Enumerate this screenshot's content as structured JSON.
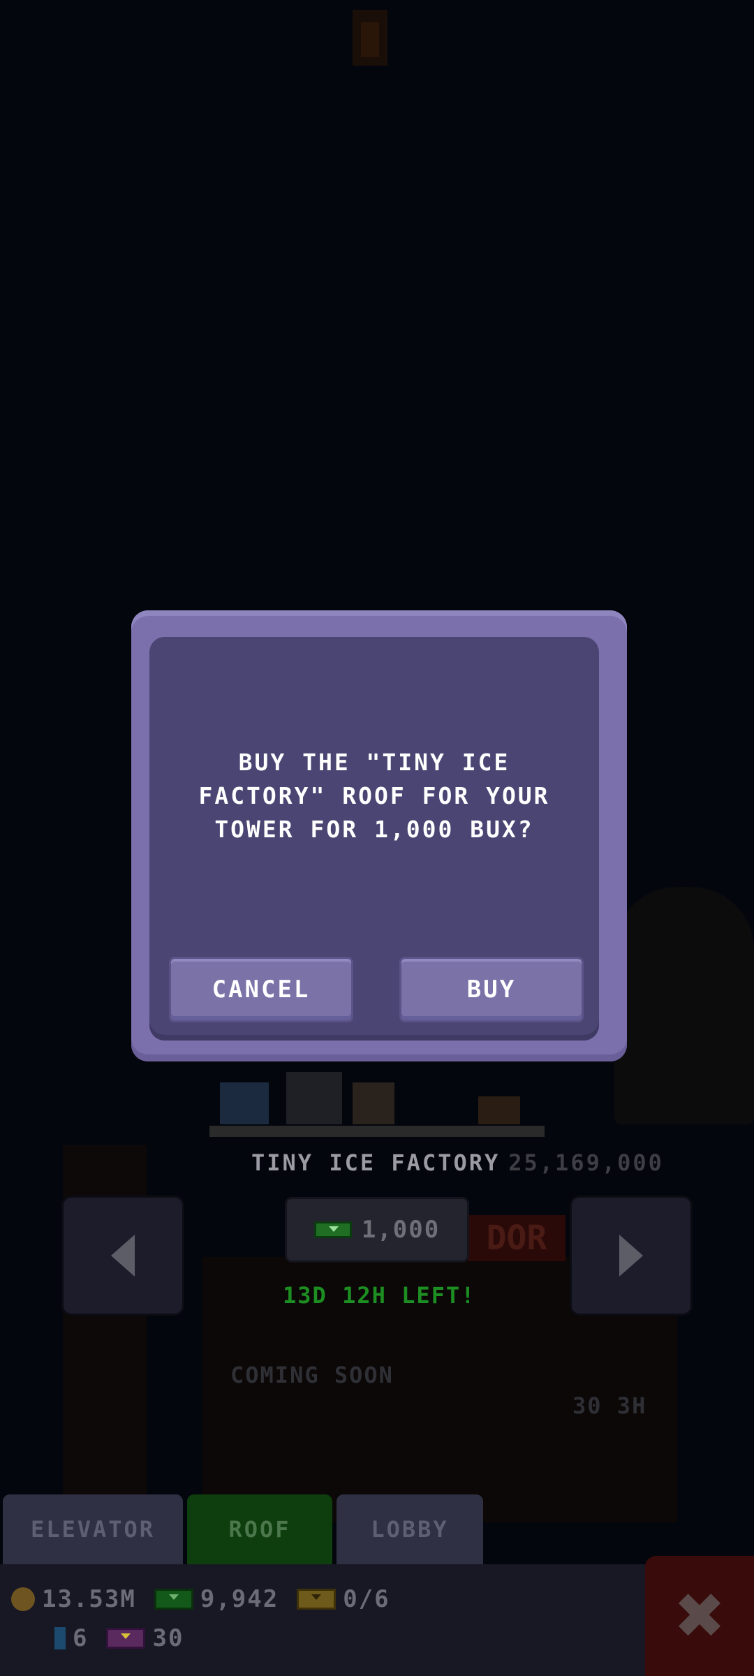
{
  "dialog": {
    "message": "BUY THE \"TINY ICE\nFACTORY\" ROOF FOR YOUR\nTOWER FOR 1,000 BUX?",
    "cancel_label": "CANCEL",
    "buy_label": "BUY"
  },
  "roof_panel": {
    "title": "TINY ICE FACTORY",
    "dim_count": "25,169,000",
    "price": "1,000",
    "time_left": "13D 12H LEFT!",
    "sale_badge": "DOR",
    "coming_soon": "COMING SOON",
    "coming_soon_time": "30 3H"
  },
  "tabs": [
    {
      "label": "ELEVATOR",
      "active": false
    },
    {
      "label": "ROOF",
      "active": true
    },
    {
      "label": "LOBBY",
      "active": false
    }
  ],
  "resources": {
    "coins": "13.53M",
    "bux": "9,942",
    "tickets": "0/6",
    "gems": "6",
    "tv_points": "30"
  },
  "icons": {
    "coin": "coin-icon",
    "bux": "bux-icon",
    "ticket": "ticket-icon",
    "gem": "gem-icon",
    "tv": "tv-icon",
    "close": "close-icon",
    "left_arrow": "arrow-left-icon",
    "right_arrow": "arrow-right-icon"
  },
  "colors": {
    "dialog_border": "#7b70ac",
    "dialog_fill": "#4a4572",
    "button_fill": "#7b72a8",
    "time_left_green": "#1d8e22",
    "active_tab": "#0e3d0e"
  }
}
